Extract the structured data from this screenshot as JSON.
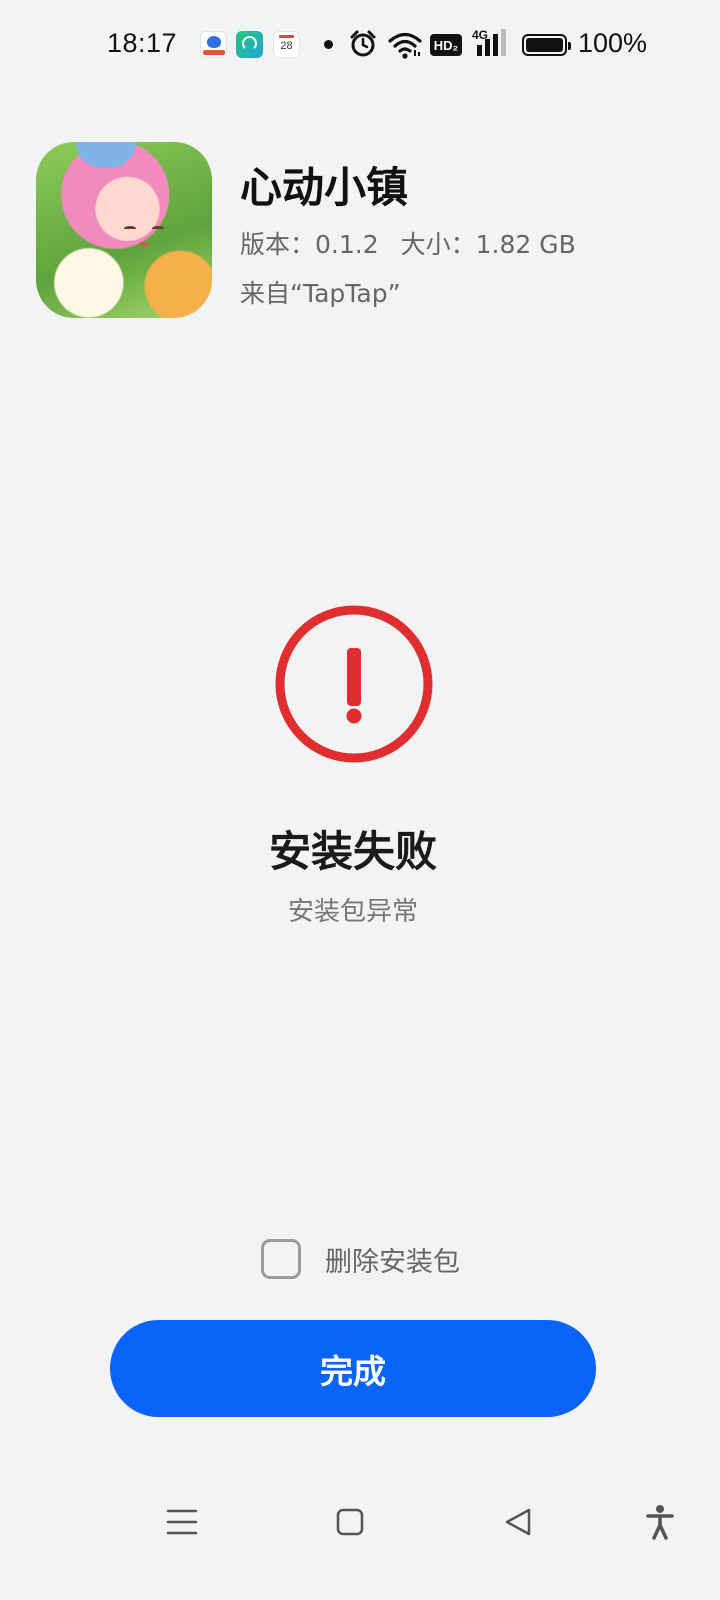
{
  "status_bar": {
    "time": "18:17",
    "notifications": [
      "baidu-app-icon",
      "green-app-icon",
      "calendar-icon"
    ],
    "calendar_day": "28",
    "icons": [
      "alarm-icon",
      "wifi-icon",
      "hd-icon",
      "signal-4g-icon",
      "battery-icon"
    ],
    "hd_label": "HD₂",
    "network_label": "4G",
    "battery_percent": "100%"
  },
  "app": {
    "name": "心动小镇",
    "version_text": "版本：0.1.2",
    "size_text": "大小：1.82 GB",
    "source_text": "来自“TapTap”"
  },
  "result": {
    "status_icon": "error-icon",
    "title": "安装失败",
    "subtitle": "安装包异常",
    "accent_color": "#e02d2d"
  },
  "options": {
    "delete_label": "删除安装包",
    "delete_checked": false
  },
  "actions": {
    "done_label": "完成",
    "button_color": "#0a64f9"
  },
  "nav_bar": {
    "buttons": [
      "menu-icon",
      "home-icon",
      "back-icon",
      "accessibility-icon"
    ]
  }
}
